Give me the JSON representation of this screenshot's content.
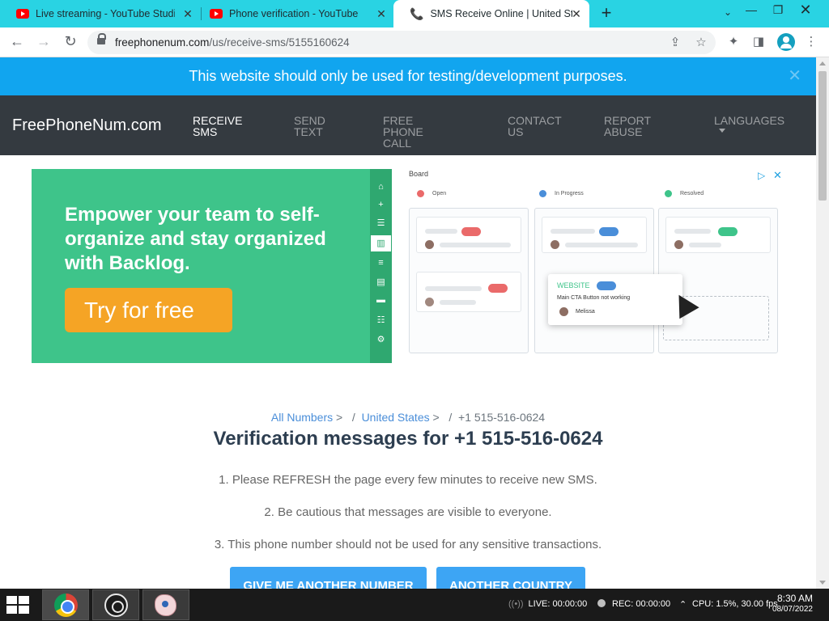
{
  "tabs": [
    {
      "title": "Live streaming - YouTube Studio",
      "active": false
    },
    {
      "title": "Phone verification - YouTube",
      "active": false
    },
    {
      "title": "SMS Receive Online | United Stat",
      "active": true
    }
  ],
  "address": {
    "host": "freephonenum.com",
    "path": "/us/receive-sms/5155160624"
  },
  "notice": {
    "text": "This website should only be used for testing/development purposes."
  },
  "nav": {
    "brand": "FreePhoneNum.com",
    "items": [
      {
        "line1": "RECEIVE",
        "line2": "SMS"
      },
      {
        "line1": "SEND",
        "line2": "TEXT"
      },
      {
        "line1": "FREE PHONE",
        "line2": "CALL"
      },
      {
        "line1": "CONTACT",
        "line2": "US"
      },
      {
        "line1": "REPORT",
        "line2": "ABUSE"
      },
      {
        "line1": "LANGUAGES",
        "line2": ""
      }
    ]
  },
  "ad": {
    "headline": "Empower your team to self-organize and stay organized with Backlog.",
    "cta": "Try for free",
    "board_title": "Board",
    "columns": [
      {
        "label": "Open",
        "color": "#ea6a6a"
      },
      {
        "label": "In Progress",
        "color": "#4a8ed9"
      },
      {
        "label": "Resolved",
        "color": "#3ec48a"
      }
    ],
    "popup_tag": "WEBSITE",
    "popup_msg": "Main CTA Button not working",
    "popup_user": "Melissa"
  },
  "breadcrumb": {
    "all_numbers": "All Numbers",
    "country": "United States",
    "number": "+1 515-516-0624",
    "sep1": ">",
    "sep2": "/"
  },
  "page_title": "Verification messages for +1 515-516-0624",
  "instructions": [
    "1. Please REFRESH the page every few minutes to receive new SMS.",
    "2. Be cautious that messages are visible to everyone.",
    "3. This phone number should not be used for any sensitive transactions."
  ],
  "buttons": {
    "another_number": "GIVE ME ANOTHER NUMBER",
    "another_country": "ANOTHER COUNTRY"
  },
  "taskbar": {
    "live": "LIVE: 00:00:00",
    "rec": "REC: 00:00:00",
    "cpu": "CPU: 1.5%, 30.00 fps",
    "time": "8:30 AM",
    "date": "08/07/2022"
  },
  "colors": {
    "tab_strip": "#29d3e3",
    "notice_bg": "#11a5ef",
    "navbar_bg": "#343a40",
    "ad_green": "#3ec48a",
    "ad_orange": "#f5a425",
    "button_blue": "#3da5f4",
    "title_color": "#2d3e50"
  }
}
